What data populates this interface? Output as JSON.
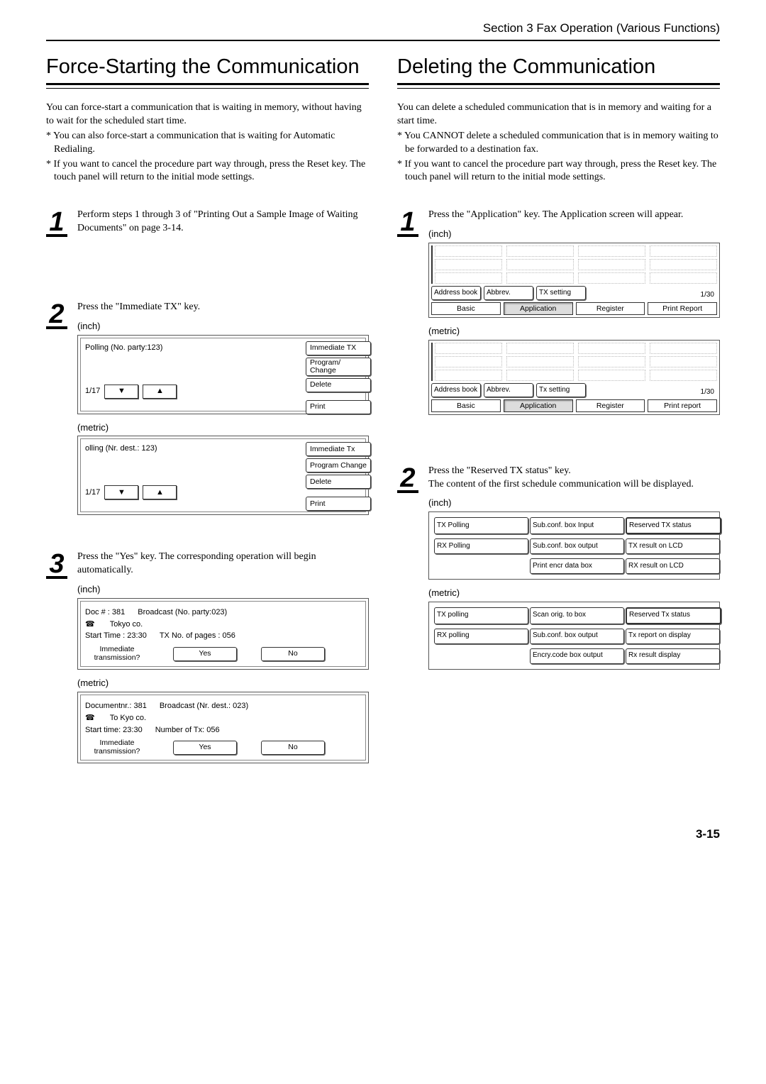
{
  "section_header": "Section 3  Fax Operation (Various Functions)",
  "page_number": "3-15",
  "left": {
    "title": "Force-Starting the Communication",
    "intro": "You can force-start a communication that is waiting in memory, without having to wait for the scheduled start time.",
    "bullets": [
      "* You can also force-start a communication that is waiting for Automatic Redialing.",
      "* If you want to cancel the procedure part way through, press the Reset key. The touch panel will return to the initial mode settings."
    ],
    "step1": "Perform steps 1 through 3 of \"Printing Out a Sample Image of Waiting Documents\" on page 3-14.",
    "step2": "Press the \"Immediate TX\" key.",
    "step3": "Press the \"Yes\" key. The corresponding operation will begin automatically.",
    "labels": {
      "inch": "(inch)",
      "metric": "(metric)"
    },
    "panel2_inch": {
      "line": "Polling  (No. party:123)",
      "btns": [
        "Immediate TX",
        "Program/ Change",
        "Delete",
        "Print"
      ],
      "page": "1/17"
    },
    "panel2_metric": {
      "line": "olling  (Nr. dest.: 123)",
      "btns": [
        "Immediate Tx",
        "Program Change",
        "Delete",
        "Print"
      ],
      "page": "1/17"
    },
    "panel3_inch": {
      "doc": "Doc #     : 381",
      "bc": "Broadcast (No. party:023)",
      "dest": "Tokyo co.",
      "start": "Start Time : 23:30",
      "pages": "TX No. of pages : 056",
      "q_lbl": "Immediate transmission?",
      "yes": "Yes",
      "no": "No"
    },
    "panel3_metric": {
      "doc": "Documentnr.: 381",
      "bc": "Broadcast  (Nr. dest.: 023)",
      "dest": "To Kyo co.",
      "start": "Start time: 23:30",
      "pages": "Number of Tx: 056",
      "q_lbl": "Immediate transmission?",
      "yes": "Yes",
      "no": "No"
    }
  },
  "right": {
    "title": "Deleting the Communication",
    "intro": "You can delete a scheduled communication that is in memory and waiting for a start time.",
    "bullets": [
      "* You CANNOT delete a scheduled communication that is in memory waiting to be forwarded to a destination fax.",
      "* If you want to cancel the procedure part way through, press the Reset key. The touch panel will return to the initial mode settings."
    ],
    "step1": "Press the \"Application\" key. The Application screen will appear.",
    "step2a": "Press the \"Reserved TX status\" key.",
    "step2b": "The content of the first schedule communication will be displayed.",
    "labels": {
      "inch": "(inch)",
      "metric": "(metric)"
    },
    "app_inch": {
      "btns": [
        "Address book",
        "Abbrev.",
        "TX setting"
      ],
      "pgn": "1/30",
      "tabs": [
        "Basic",
        "Application",
        "Register",
        "Print Report"
      ]
    },
    "app_metric": {
      "btns": [
        "Address book",
        "Abbrev.",
        "Tx setting"
      ],
      "pgn": "1/30",
      "tabs": [
        "Basic",
        "Application",
        "Register",
        "Print report"
      ]
    },
    "res_inch": [
      "TX Polling",
      "Sub.conf. box Input",
      "Reserved TX status",
      "RX Polling",
      "Sub.conf. box output",
      "TX result on LCD",
      "",
      "Print encr data box",
      "RX result on LCD"
    ],
    "res_metric": [
      "TX polling",
      "Scan orig. to box",
      "Reserved Tx status",
      "RX polling",
      "Sub.conf. box output",
      "Tx report on display",
      "",
      "Encry.code box output",
      "Rx result display"
    ]
  }
}
